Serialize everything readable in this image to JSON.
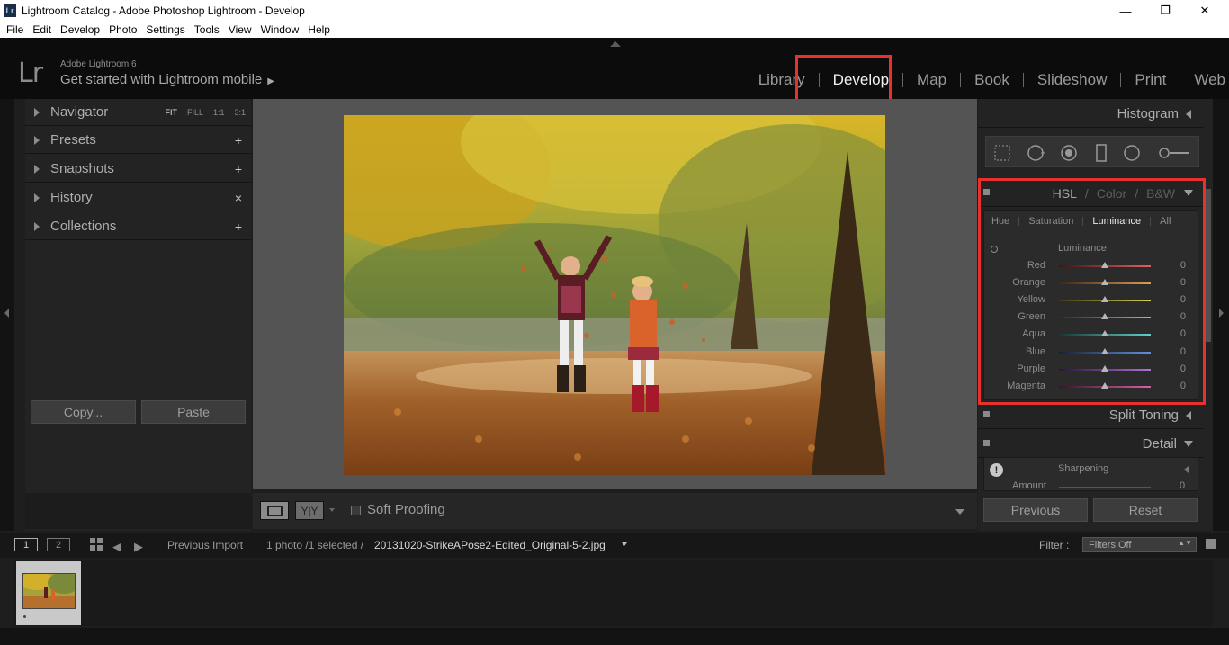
{
  "window": {
    "app_icon": "Lr",
    "title": "Lightroom Catalog - Adobe Photoshop Lightroom - Develop",
    "controls": [
      "—",
      "❐",
      "✕"
    ]
  },
  "menu": [
    "File",
    "Edit",
    "Develop",
    "Photo",
    "Settings",
    "Tools",
    "View",
    "Window",
    "Help"
  ],
  "identity": {
    "logo": "Lr",
    "version": "Adobe Lightroom 6",
    "mobile": "Get started with Lightroom mobile"
  },
  "modules": [
    "Library",
    "Develop",
    "Map",
    "Book",
    "Slideshow",
    "Print",
    "Web"
  ],
  "active_module": "Develop",
  "left_panel": {
    "navigator": "Navigator",
    "zoom_options": [
      "FIT",
      "FILL",
      "1:1",
      "3:1"
    ],
    "presets": "Presets",
    "snapshots": "Snapshots",
    "history": "History",
    "collections": "Collections",
    "plus": "+",
    "close": "×",
    "copy_button": "Copy...",
    "paste_button": "Paste"
  },
  "toolbar": {
    "soft_proofing": "Soft Proofing",
    "before_after": "Y|Y"
  },
  "right_panel": {
    "histogram": "Histogram",
    "hsl_tabs_title": [
      "HSL",
      "Color",
      "B&W"
    ],
    "hsl_sep": "/",
    "hsl_subtabs": [
      "Hue",
      "Saturation",
      "Luminance",
      "All"
    ],
    "luminance_title": "Luminance",
    "sliders": [
      {
        "name": "Red",
        "value": "0",
        "gradient": "linear-gradient(90deg,#3d1515,#e0605f)"
      },
      {
        "name": "Orange",
        "value": "0",
        "gradient": "linear-gradient(90deg,#3d2815,#e09a50)"
      },
      {
        "name": "Yellow",
        "value": "0",
        "gradient": "linear-gradient(90deg,#3d3815,#d8d055)"
      },
      {
        "name": "Green",
        "value": "0",
        "gradient": "linear-gradient(90deg,#1d3815,#8ad060)"
      },
      {
        "name": "Aqua",
        "value": "0",
        "gradient": "linear-gradient(90deg,#153835,#60d0c8)"
      },
      {
        "name": "Blue",
        "value": "0",
        "gradient": "linear-gradient(90deg,#152038,#6090e0)"
      },
      {
        "name": "Purple",
        "value": "0",
        "gradient": "linear-gradient(90deg,#2a1538,#b070d8)"
      },
      {
        "name": "Magenta",
        "value": "0",
        "gradient": "linear-gradient(90deg,#38152a,#d860a8)"
      }
    ],
    "split_toning": "Split Toning",
    "detail": "Detail",
    "sharpening": "Sharpening",
    "amount": "Amount",
    "amount_value": "0",
    "warn": "!",
    "previous_button": "Previous",
    "reset_button": "Reset"
  },
  "filmbar": {
    "view1": "1",
    "view2": "2",
    "prev_arrow": "◀",
    "next_arrow": "▶",
    "source": "Previous Import",
    "count": "1 photo /1 selected /",
    "filename": "20131020-StrikeAPose2-Edited_Original-5-2.jpg",
    "filter_label": "Filter :",
    "filter_value": "Filters Off",
    "filter_arrows": "▲▼"
  },
  "colors": {
    "highlight": "#e8302d",
    "panel": "#232323",
    "center_bg": "#545454"
  }
}
